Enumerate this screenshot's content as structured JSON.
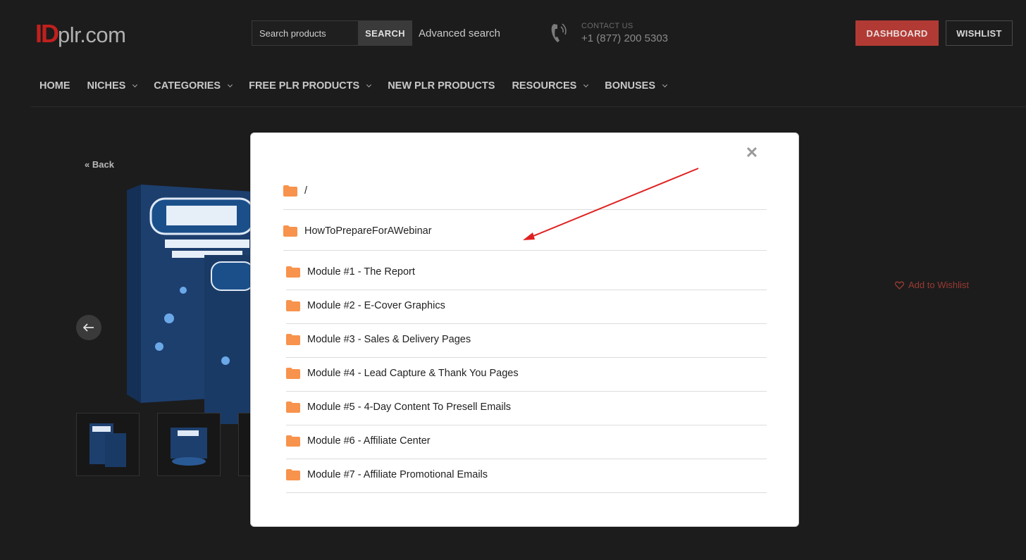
{
  "header": {
    "logo_id": "ID",
    "logo_rest": "plr.com",
    "search_placeholder": "Search products",
    "search_button": "SEARCH",
    "advanced_search": "Advanced search",
    "contact_label": "CONTACT US",
    "contact_phone": "+1 (877) 200 5303",
    "dashboard_button": "DASHBOARD",
    "wishlist_button": "WISHLIST"
  },
  "nav": [
    {
      "label": "HOME",
      "dropdown": false
    },
    {
      "label": "NICHES",
      "dropdown": true
    },
    {
      "label": "CATEGORIES",
      "dropdown": true
    },
    {
      "label": "FREE PLR PRODUCTS",
      "dropdown": true
    },
    {
      "label": "NEW PLR PRODUCTS",
      "dropdown": false
    },
    {
      "label": "RESOURCES",
      "dropdown": true
    },
    {
      "label": "BONUSES",
      "dropdown": true
    }
  ],
  "product": {
    "back_link": "« Back",
    "add_to_wishlist": "Add to Wishlist"
  },
  "modal": {
    "close_icon": "close-icon",
    "root_folder": "/",
    "main_folder": "HowToPrepareForAWebinar",
    "modules": [
      "Module #1 - The Report",
      "Module #2 - E-Cover Graphics",
      "Module #3 - Sales & Delivery Pages",
      "Module #4 - Lead Capture & Thank You Pages",
      "Module #5 - 4-Day Content To Presell Emails",
      "Module #6 - Affiliate Center",
      "Module #7 - Affiliate Promotional Emails"
    ]
  },
  "colors": {
    "background": "#1c1c1c",
    "brand_red": "#c0201e",
    "dashboard_red": "#b23a34",
    "folder_orange": "#f7934c",
    "annotation_arrow": "#e02020"
  }
}
